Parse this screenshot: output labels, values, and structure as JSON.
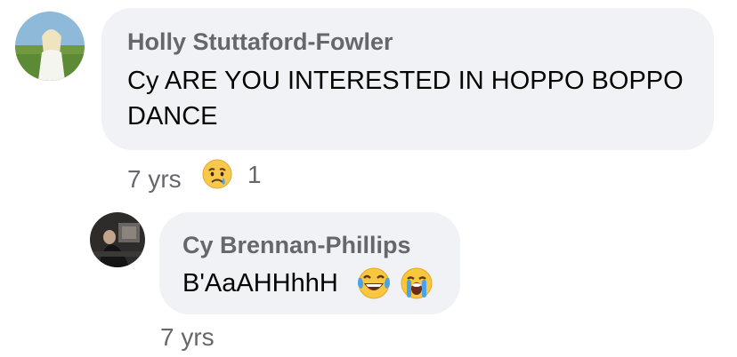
{
  "comments": [
    {
      "author": "Holly Stuttaford-Fowler",
      "text_line1": "Cy ARE YOU INTERESTED IN HOPPO BOPPO",
      "text_line2": "DANCE",
      "time": "7 yrs",
      "reaction": {
        "icon": "sad-reaction-icon",
        "count": "1"
      }
    }
  ],
  "replies": [
    {
      "author": "Cy Brennan-Phillips",
      "text": "B'AaAHHhhH",
      "emojis": [
        "laughing-tears-emoji",
        "loudly-crying-emoji"
      ],
      "time": "7 yrs"
    }
  ],
  "colors": {
    "bubble": "#f0f2f5",
    "name": "#65676b",
    "text": "#050505",
    "meta": "#65676b"
  }
}
